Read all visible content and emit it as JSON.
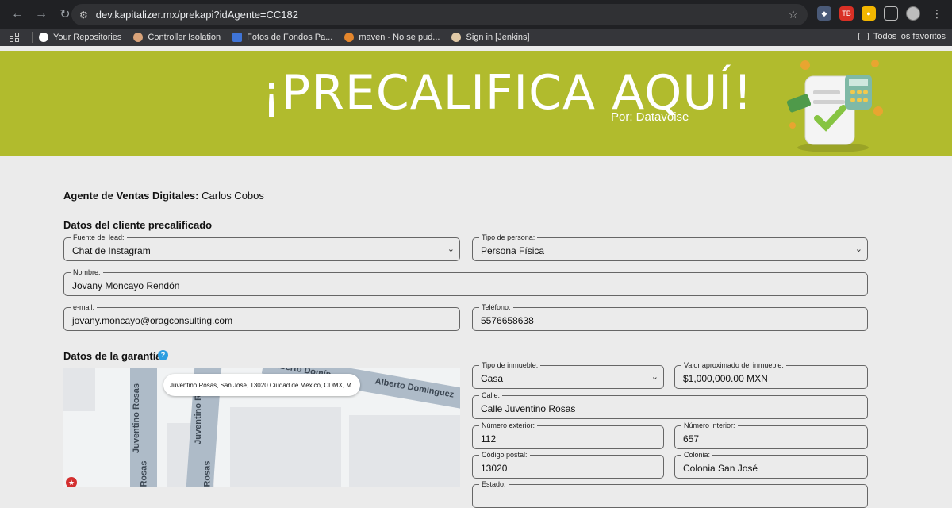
{
  "browser": {
    "url": "dev.kapitalizer.mx/prekapi?idAgente=CC182",
    "bookmarks": [
      {
        "label": "Your Repositories",
        "color": "#ffffff"
      },
      {
        "label": "Controller Isolation",
        "color": "#d9a37a"
      },
      {
        "label": "Fotos de Fondos Pa...",
        "color": "#3f74d6"
      },
      {
        "label": "maven - No se pud...",
        "color": "#e4862c"
      },
      {
        "label": "Sign in [Jenkins]",
        "color": "#e0c9a6"
      }
    ],
    "all_bookmarks": "Todos los favoritos"
  },
  "hero": {
    "title": "¡PRECALIFICA AQUÍ!",
    "subtitle": "Por: Datavoise",
    "bg_color": "#b1bb2d"
  },
  "agent": {
    "label": "Agente de Ventas Digitales:",
    "name": "Carlos Cobos"
  },
  "client_section": {
    "title": "Datos del cliente precalificado",
    "lead_source": {
      "label": "Fuente del lead:",
      "value": "Chat de Instagram"
    },
    "person_type": {
      "label": "Tipo de persona:",
      "value": "Persona Física"
    },
    "name": {
      "label": "Nombre:",
      "value": "Jovany Moncayo Rendón"
    },
    "email": {
      "label": "e-mail:",
      "value": "jovany.moncayo@oragconsulting.com"
    },
    "phone": {
      "label": "Teléfono:",
      "value": "5576658638"
    }
  },
  "guarantee_section": {
    "title": "Datos de la garantía",
    "help": "?",
    "map": {
      "address_bubble": "Juventino Rosas, San José, 13020 Ciudad de México, CDMX, M",
      "street_labels": [
        "Juventino Rosas",
        "Juventino Ro",
        "Alberto Domínguez",
        "Alberto Domín",
        "Rosas",
        "Rosas"
      ]
    },
    "property_type": {
      "label": "Tipo de inmueble:",
      "value": "Casa"
    },
    "property_value": {
      "label": "Valor aproximado del inmueble:",
      "value": "$1,000,000.00 MXN"
    },
    "street": {
      "label": "Calle:",
      "value": "Calle Juventino Rosas"
    },
    "ext_number": {
      "label": "Número exterior:",
      "value": "112"
    },
    "int_number": {
      "label": "Número interior:",
      "value": "657"
    },
    "postal_code": {
      "label": "Código postal:",
      "value": "13020"
    },
    "colonia": {
      "label": "Colonia:",
      "value": "Colonia San José"
    },
    "state": {
      "label": "Estado:"
    }
  }
}
